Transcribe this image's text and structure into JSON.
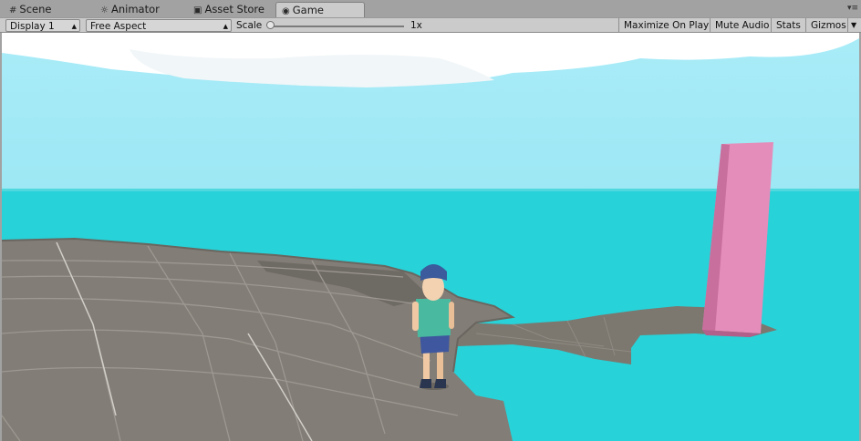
{
  "tabs": [
    {
      "label": "Scene",
      "icon": "grid-icon"
    },
    {
      "label": "Animator",
      "icon": "animator-icon"
    },
    {
      "label": "Asset Store",
      "icon": "shopping-bag-icon"
    },
    {
      "label": "Game",
      "icon": "game-controller-icon",
      "active": true
    }
  ],
  "toolbar": {
    "display": "Display 1",
    "aspect": "Free Aspect",
    "scale_label": "Scale",
    "scale_value": "1x",
    "scale_fraction": 0.0,
    "maximize_on_play": "Maximize On Play",
    "mute_audio": "Mute Audio",
    "stats": "Stats",
    "gizmos": "Gizmos"
  },
  "colors": {
    "sky": "#a3e9f6",
    "sea": "#27d2d8",
    "ground": "#817c75",
    "pillar": "#e58dba",
    "character_shirt": "#49b9a0",
    "character_hair": "#3b5b9c"
  }
}
